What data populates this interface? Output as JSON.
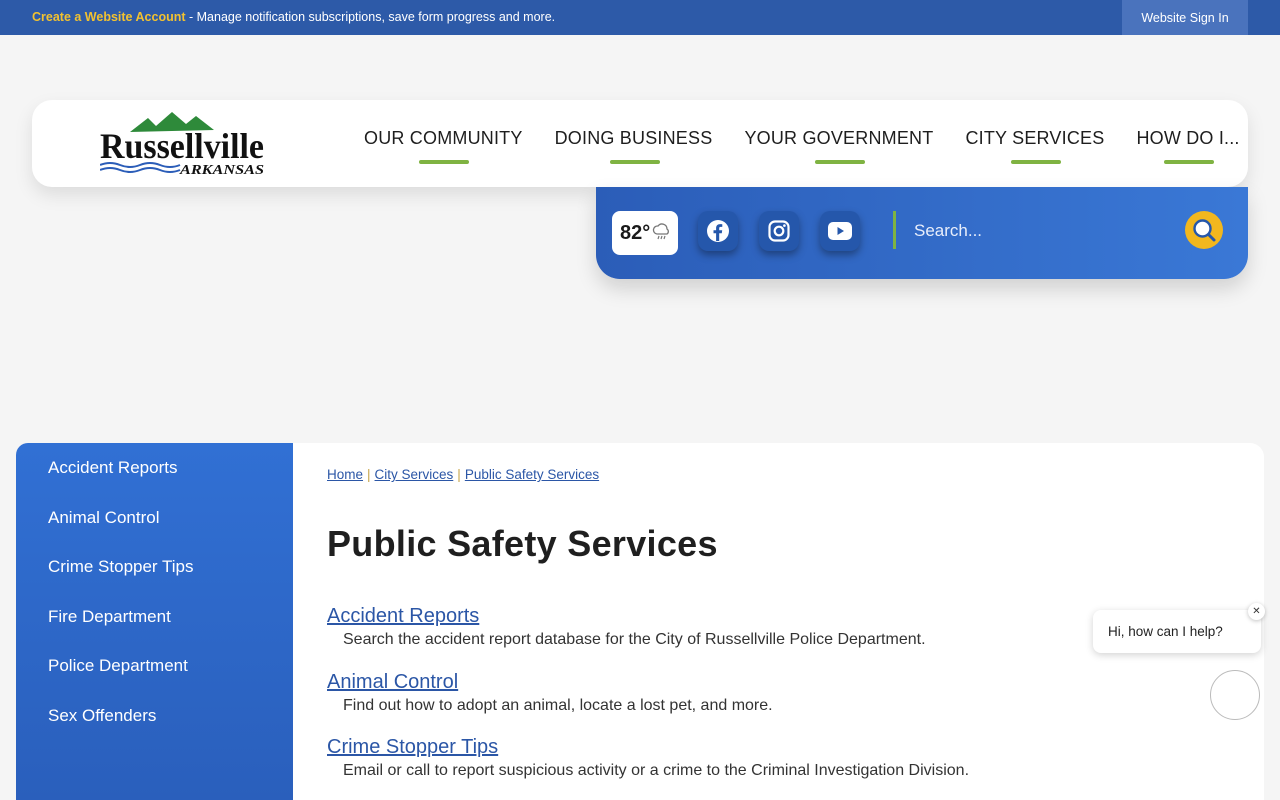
{
  "topbar": {
    "create_account": "Create a Website Account",
    "tagline": " - Manage notification subscriptions, save form progress and more.",
    "signin_label": "Website Sign In"
  },
  "logo": {
    "line1": "Russellville",
    "line2": "ARKANSAS"
  },
  "nav": [
    {
      "label": "OUR COMMUNITY"
    },
    {
      "label": "DOING BUSINESS"
    },
    {
      "label": "YOUR GOVERNMENT"
    },
    {
      "label": "CITY SERVICES"
    },
    {
      "label": "HOW DO I..."
    }
  ],
  "weather": {
    "temp": "82°",
    "icon": "rain-cloud-icon"
  },
  "social": [
    "facebook-icon",
    "instagram-icon",
    "youtube-icon"
  ],
  "search": {
    "placeholder": "Search..."
  },
  "sidebar": {
    "items": [
      {
        "label": "Accident Reports"
      },
      {
        "label": "Animal Control"
      },
      {
        "label": "Crime Stopper Tips"
      },
      {
        "label": "Fire Department"
      },
      {
        "label": "Police Department"
      },
      {
        "label": "Sex Offenders"
      }
    ]
  },
  "breadcrumb": [
    "Home",
    "City Services",
    "Public Safety Services"
  ],
  "page_title": "Public Safety Services",
  "entries": [
    {
      "title": "Accident Reports",
      "desc": "Search the accident report database for the City of Russellville Police Department."
    },
    {
      "title": "Animal Control",
      "desc": "Find out how to adopt an animal, locate a lost pet, and more."
    },
    {
      "title": "Crime Stopper Tips",
      "desc": "Email or call to report suspicious activity or a crime to the Criminal Investigation Division."
    }
  ],
  "chat": {
    "prompt": "Hi, how can I help?",
    "close": "✕"
  },
  "colors": {
    "brand_blue": "#2d5aa8",
    "accent_green": "#7fb342",
    "accent_gold": "#f2c230"
  }
}
